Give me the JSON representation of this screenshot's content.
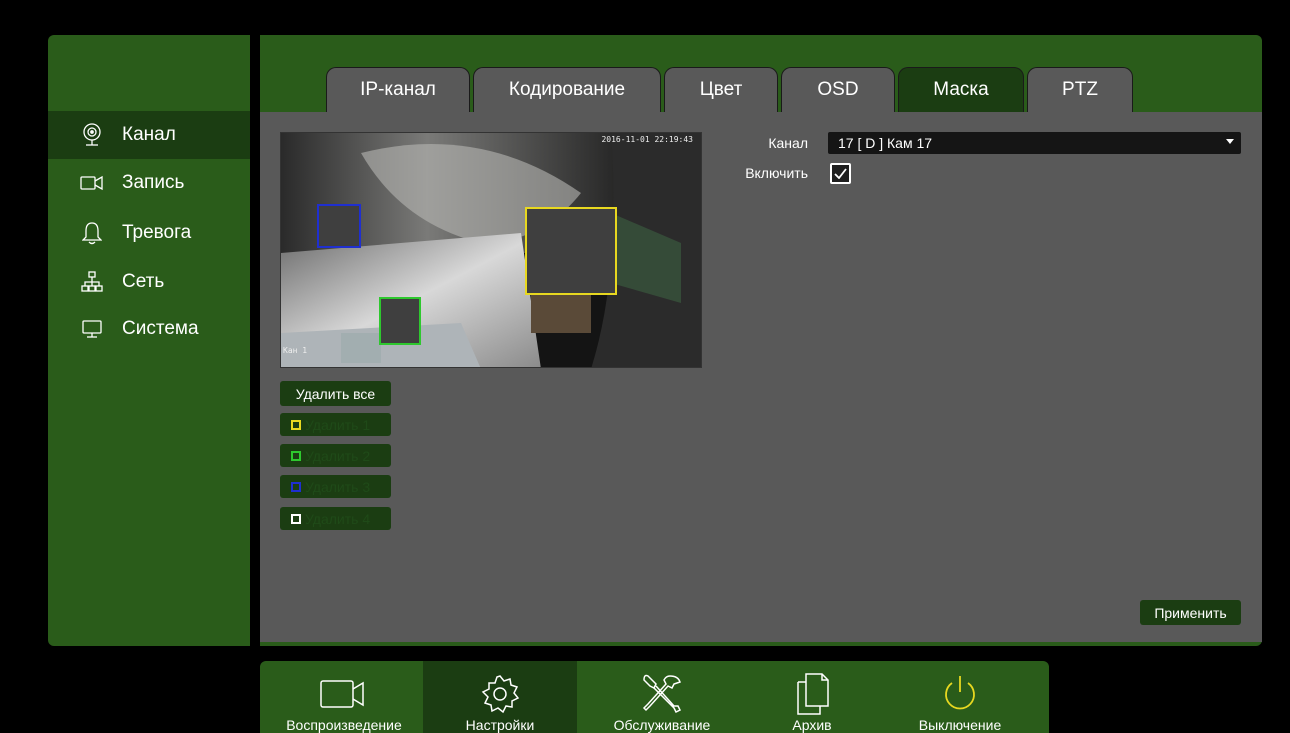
{
  "sidebar": {
    "items": [
      {
        "label": "Канал",
        "icon": "webcam-icon",
        "active": true
      },
      {
        "label": "Запись",
        "icon": "video-camera-icon",
        "active": false
      },
      {
        "label": "Тревога",
        "icon": "bell-icon",
        "active": false
      },
      {
        "label": "Сеть",
        "icon": "network-icon",
        "active": false
      },
      {
        "label": "Система",
        "icon": "monitor-icon",
        "active": false
      }
    ]
  },
  "tabs": [
    {
      "label": "IP-канал",
      "active": false
    },
    {
      "label": "Кодирование",
      "active": false
    },
    {
      "label": "Цвет",
      "active": false
    },
    {
      "label": "OSD",
      "active": false
    },
    {
      "label": "Маска",
      "active": true
    },
    {
      "label": "PTZ",
      "active": false
    }
  ],
  "preview": {
    "timestamp": "2016-11-01 22:19:43",
    "channel_label": "Кан 1",
    "masks": [
      {
        "id": 1,
        "color": "#e8d820"
      },
      {
        "id": 2,
        "color": "#2ec82e"
      },
      {
        "id": 3,
        "color": "#1f2fd0"
      },
      {
        "id": 4,
        "color": "#ffffff"
      }
    ]
  },
  "mask_controls": {
    "delete_all_label": "Удалить все",
    "delete_buttons": [
      {
        "label": "Удалить 1",
        "color": "#e8d820"
      },
      {
        "label": "Удалить 2",
        "color": "#2ec82e"
      },
      {
        "label": "Удалить 3",
        "color": "#1f2fd0"
      },
      {
        "label": "Удалить 4",
        "color": "#ffffff"
      }
    ]
  },
  "form": {
    "channel_label": "Канал",
    "channel_value": "17 [ D ] Кам 17",
    "enable_label": "Включить",
    "enable_checked": true
  },
  "apply_label": "Применить",
  "bottombar": {
    "items": [
      {
        "label": "Воспроизведение",
        "icon": "camera-icon",
        "active": false
      },
      {
        "label": "Настройки",
        "icon": "gear-icon",
        "active": true
      },
      {
        "label": "Обслуживание",
        "icon": "tools-icon",
        "active": false
      },
      {
        "label": "Архив",
        "icon": "files-icon",
        "active": false
      },
      {
        "label": "Выключение",
        "icon": "power-icon",
        "active": false
      }
    ]
  },
  "colors": {
    "panel_green": "#2a5c1a",
    "active_green": "#1b3d12",
    "content_gray": "#595959",
    "power_yellow": "#e8d820"
  }
}
